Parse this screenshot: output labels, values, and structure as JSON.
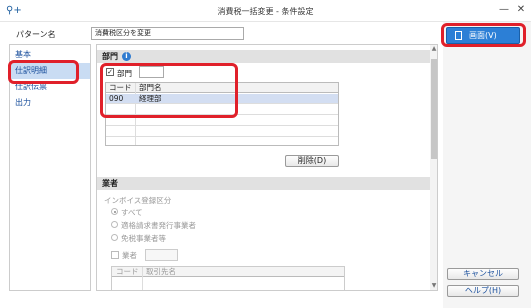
{
  "window": {
    "title": "消費税一括変更 - 条件設定"
  },
  "pattern": {
    "label": "パターン名",
    "value": "消費税区分を変更"
  },
  "sidebar": {
    "items": [
      {
        "label": "基本",
        "selected": false
      },
      {
        "label": "仕訳明細",
        "selected": true
      },
      {
        "label": "仕訳伝票",
        "selected": false
      },
      {
        "label": "出力",
        "selected": false
      }
    ]
  },
  "dept": {
    "section_title": "部門",
    "checkbox_label": "部門",
    "checked": true,
    "columns": [
      "コード",
      "部門名"
    ],
    "rows": [
      {
        "code": "090",
        "name": "経理部"
      }
    ],
    "delete_label": "削除(D)"
  },
  "vendor": {
    "section_title": "業者",
    "invoice_label": "インボイス登録区分",
    "radios": [
      "すべて",
      "適格請求書発行事業者",
      "免税事業者等"
    ],
    "selected_radio": 0,
    "checkbox_label": "業者",
    "columns": [
      "コード",
      "取引先名"
    ]
  },
  "actions": {
    "screen_label": "画面(V)",
    "cancel_label": "キャンセル",
    "help_label": "ヘルプ(H)"
  }
}
